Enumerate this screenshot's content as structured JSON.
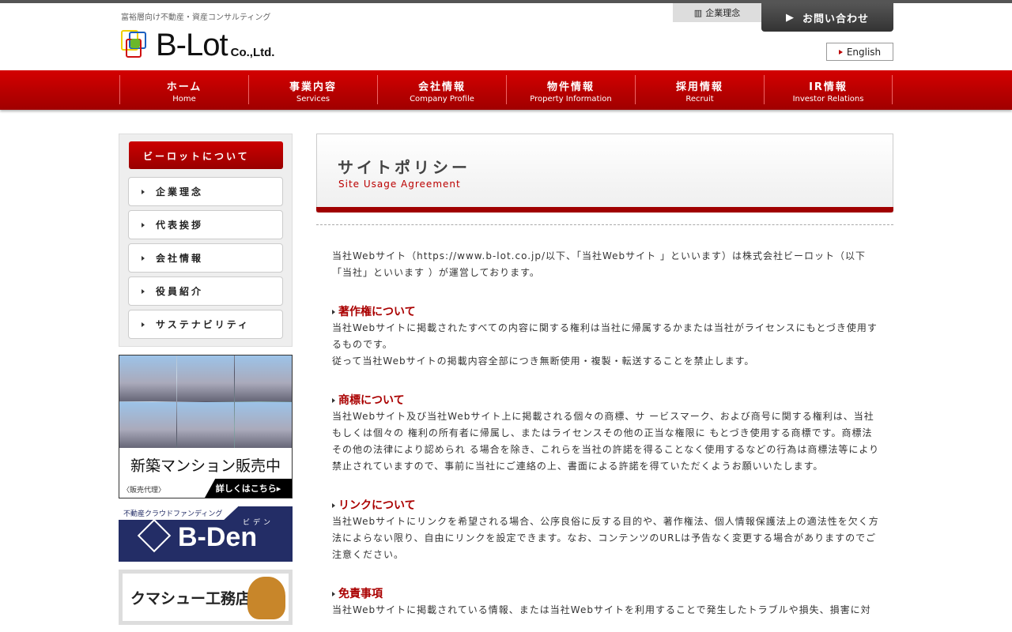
{
  "header": {
    "tagline": "富裕層向け不動産・資産コンサルティング",
    "logo_name": "B-Lot",
    "logo_suffix": "Co.,Ltd.",
    "philosophy_link": "企業理念",
    "contact_button": "お問い合わせ",
    "english_link": "English"
  },
  "nav": [
    {
      "jp": "ホーム",
      "en": "Home"
    },
    {
      "jp": "事業内容",
      "en": "Services"
    },
    {
      "jp": "会社情報",
      "en": "Company Profile"
    },
    {
      "jp": "物件情報",
      "en": "Property Information"
    },
    {
      "jp": "採用情報",
      "en": "Recruit"
    },
    {
      "jp": "IR情報",
      "en": "Investor Relations"
    }
  ],
  "sidebar": {
    "heading": "ビーロットについて",
    "items": [
      "企業理念",
      "代表挨拶",
      "会社情報",
      "役員紹介",
      "サステナビリティ"
    ]
  },
  "banners": {
    "mansion": {
      "title": "新築マンション販売中",
      "note": "〈販売代理〉",
      "more": "詳しくはこちら"
    },
    "bden": {
      "label": "不動産クラウドファンディング",
      "name": "B-Den",
      "kana": "ビデン"
    },
    "kumashu": {
      "name": "クマシュー工務店"
    }
  },
  "page": {
    "title_jp": "サイトポリシー",
    "title_en": "Site Usage Agreement",
    "intro": "当社Webサイト（https://www.b-lot.co.jp/以下、「当社Webサイト 」といいます）は株式会社ビーロット（以下「当社」といいます ）が運営しております。",
    "sections": [
      {
        "heading": "著作権について",
        "body": [
          "当社Webサイトに掲載されたすべての内容に関する権利は当社に帰属するかまたは当社がライセンスにもとづき使用するものです。",
          "従って当社Webサイトの掲載内容全部につき無断使用・複製・転送することを禁止します。"
        ]
      },
      {
        "heading": "商標について",
        "body": [
          "当社Webサイト及び当社Webサイト上に掲載される個々の商標、サ ービスマーク、および商号に関する権利は、当社もしくは個々の 権利の所有者に帰属し、またはライセンスその他の正当な権限に もとづき使用する商標です。商標法その他の法律により認められ る場合を除き、これらを当社の許諾を得ることなく使用するなどの行為は商標法等により禁止されていますので、事前に当社にご連絡の上、書面による許諾を得ていただくようお願いいたします。"
        ]
      },
      {
        "heading": "リンクについて",
        "body": [
          "当社Webサイトにリンクを希望される場合、公序良俗に反する目的や、著作権法、個人情報保護法上の適法性を欠く方法によらない限り、自由にリンクを設定できます。なお、コンテンツのURLは予告なく変更する場合がありますのでご注意ください。"
        ]
      },
      {
        "heading": "免責事項",
        "body": [
          "当社Webサイトに掲載されている情報、または当社Webサイトを利用することで発生したトラブルや損失、損害に対"
        ]
      }
    ]
  },
  "colors": {
    "brand_red": "#c00000",
    "dark_red": "#a00000"
  }
}
